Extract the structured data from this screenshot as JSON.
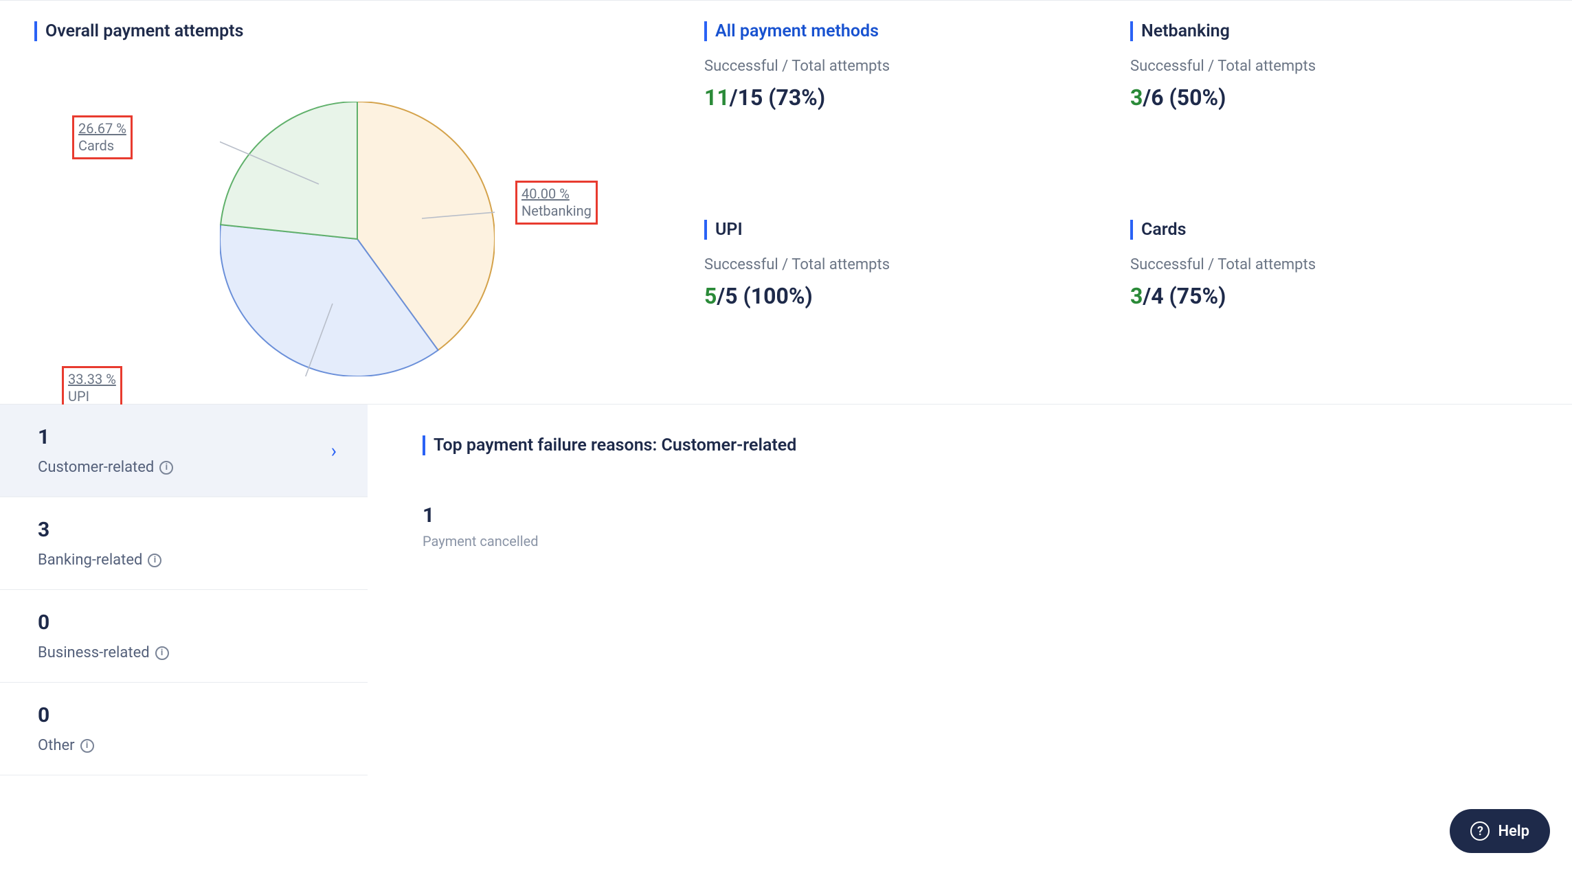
{
  "overall": {
    "title": "Overall payment attempts",
    "labels": {
      "cards": {
        "pct": "26.67 %",
        "name": "Cards"
      },
      "upi": {
        "pct": "33.33 %",
        "name": "UPI"
      },
      "netbanking": {
        "pct": "40.00 %",
        "name": "Netbanking"
      }
    }
  },
  "stats": {
    "all": {
      "title": "All payment methods",
      "sub": "Successful / Total attempts",
      "success": "11",
      "total": "/15 (73%)"
    },
    "netbanking": {
      "title": "Netbanking",
      "sub": "Successful / Total attempts",
      "success": "3",
      "total": "/6 (50%)"
    },
    "upi": {
      "title": "UPI",
      "sub": "Successful / Total attempts",
      "success": "5",
      "total": "/5 (100%)"
    },
    "cards": {
      "title": "Cards",
      "sub": "Successful / Total attempts",
      "success": "3",
      "total": "/4 (75%)"
    }
  },
  "failures": {
    "categories": {
      "customer": {
        "count": "1",
        "label": "Customer-related"
      },
      "banking": {
        "count": "3",
        "label": "Banking-related"
      },
      "business": {
        "count": "0",
        "label": "Business-related"
      },
      "other": {
        "count": "0",
        "label": "Other"
      }
    },
    "detail": {
      "title": "Top payment failure reasons: Customer-related",
      "reasons": [
        {
          "count": "1",
          "label": "Payment cancelled"
        }
      ]
    }
  },
  "help": {
    "label": "Help"
  },
  "chart_data": {
    "type": "pie",
    "title": "Overall payment attempts",
    "categories": [
      "Netbanking",
      "UPI",
      "Cards"
    ],
    "values": [
      40.0,
      33.33,
      26.67
    ],
    "colors": [
      "#fdf2e0",
      "#e4ecfb",
      "#e8f4e9"
    ]
  }
}
